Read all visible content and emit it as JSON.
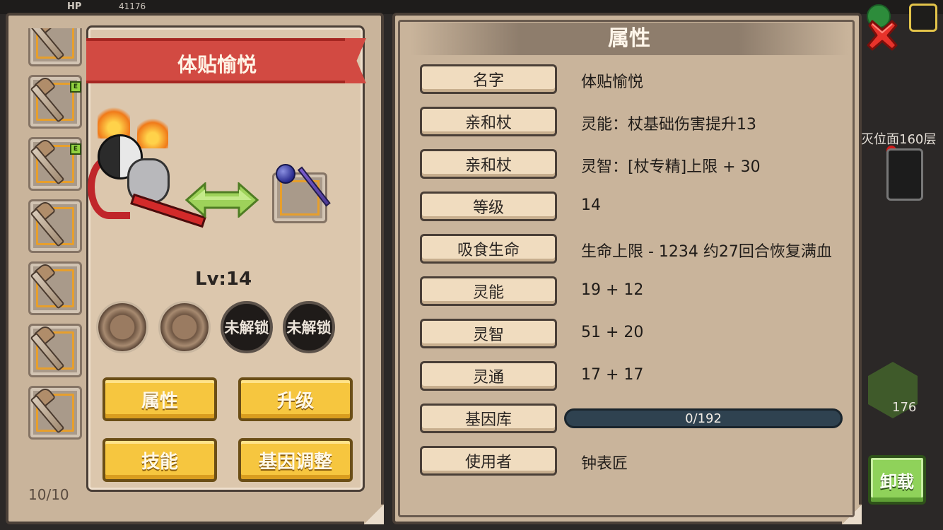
{
  "topbar": {
    "hp_label": "HP",
    "hp_value": "41176"
  },
  "background": {
    "floor_text": "灭位面160层",
    "badge_count": "176"
  },
  "equipment": {
    "slot_count_text": "10/10",
    "slots": [
      {
        "equipped": false
      },
      {
        "equipped": true,
        "tag": "E"
      },
      {
        "equipped": true,
        "tag": "E"
      },
      {
        "equipped": false
      },
      {
        "equipped": false
      },
      {
        "equipped": false
      },
      {
        "equipped": false
      }
    ]
  },
  "detail": {
    "name": "体贴愉悦",
    "level_text": "Lv:14",
    "gems": [
      {
        "state": "empty"
      },
      {
        "state": "empty"
      },
      {
        "state": "locked",
        "label": "未解锁"
      },
      {
        "state": "locked",
        "label": "未解锁"
      }
    ],
    "buttons": {
      "attributes": "属性",
      "upgrade": "升级",
      "skills": "技能",
      "gene_adjust": "基因调整"
    }
  },
  "attributes_panel": {
    "title": "属性",
    "rows": [
      {
        "label": "名字",
        "value": "体贴愉悦"
      },
      {
        "label": "亲和杖",
        "value": "灵能：杖基础伤害提升13"
      },
      {
        "label": "亲和杖",
        "value": "灵智：[杖专精]上限 + 30"
      },
      {
        "label": "等级",
        "value": "14"
      },
      {
        "label": "吸食生命",
        "value": "生命上限 - 1234  约27回合恢复满血"
      },
      {
        "label": "灵能",
        "value": "19 + 12"
      },
      {
        "label": "灵智",
        "value": "51 + 20"
      },
      {
        "label": "灵通",
        "value": "17 + 17"
      },
      {
        "label": "基因库",
        "value": ""
      },
      {
        "label": "使用者",
        "value": "钟表匠"
      }
    ],
    "gene_bank": {
      "current": 0,
      "max": 192,
      "text": "0/192"
    }
  },
  "actions": {
    "unload": "卸载"
  },
  "colors": {
    "panel": "#c9b49b",
    "ribbon": "#d24a42",
    "button_yellow": "#f6c63f",
    "button_green": "#8fd25a",
    "close_red": "#e8332b"
  },
  "icons": {
    "close": "close-x-icon",
    "swap": "swap-arrows-icon",
    "wand": "wand-icon"
  }
}
